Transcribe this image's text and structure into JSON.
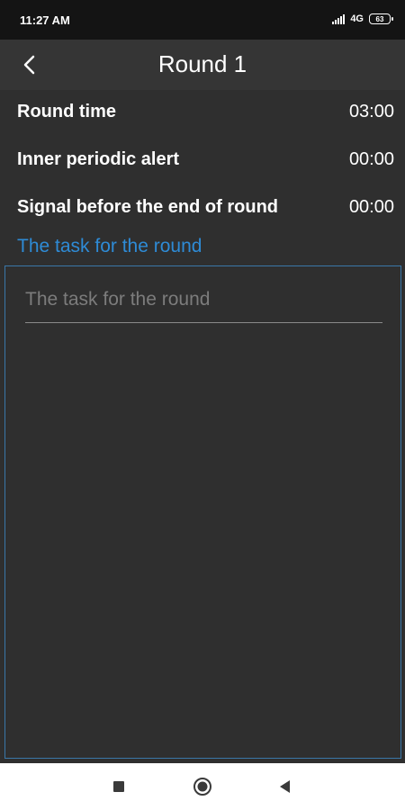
{
  "status_bar": {
    "time": "11:27 AM",
    "network": "4G",
    "battery": "63",
    "icons": [
      "signal-icon",
      "battery-icon"
    ]
  },
  "header": {
    "title": "Round 1",
    "back_icon": "chevron-left-icon"
  },
  "settings": [
    {
      "label": "Round time",
      "value": "03:00"
    },
    {
      "label": "Inner periodic alert",
      "value": "00:00"
    },
    {
      "label": "Signal before the end of round",
      "value": "00:00"
    }
  ],
  "task": {
    "heading": "The task for the round",
    "value": "",
    "placeholder": "The task for the round"
  },
  "navigation": {
    "icons": [
      "recent-apps-icon",
      "home-icon",
      "back-icon"
    ]
  },
  "colors": {
    "accent": "#2e8bd6",
    "background": "#2f2f2f",
    "status_bar": "#141414",
    "nav_bar": "#ffffff"
  }
}
